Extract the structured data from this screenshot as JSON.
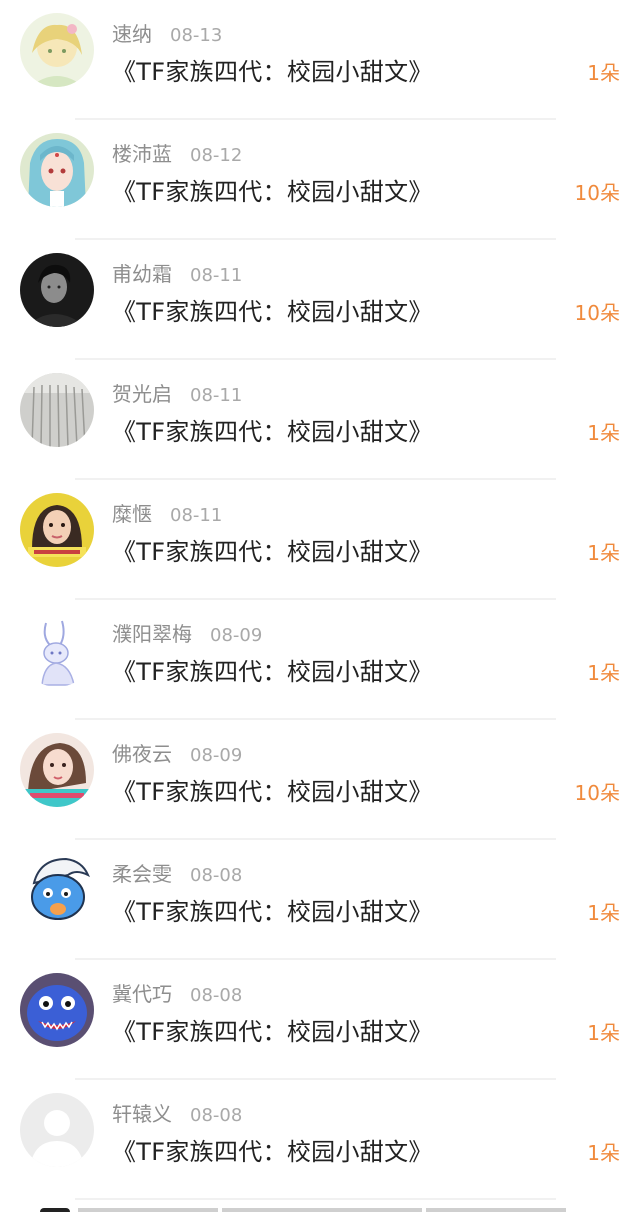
{
  "items": [
    {
      "user": "速纳",
      "date": "08-13",
      "book": "《TF家族四代：校园小甜文》",
      "amount": "1朵",
      "avatar": "avatar-anime-blonde"
    },
    {
      "user": "楼沛蓝",
      "date": "08-12",
      "book": "《TF家族四代：校园小甜文》",
      "amount": "10朵",
      "avatar": "avatar-anime-bluehair"
    },
    {
      "user": "甫幼霜",
      "date": "08-11",
      "book": "《TF家族四代：校园小甜文》",
      "amount": "10朵",
      "avatar": "avatar-dark-portrait"
    },
    {
      "user": "贺光启",
      "date": "08-11",
      "book": "《TF家族四代：校园小甜文》",
      "amount": "1朵",
      "avatar": "avatar-grey-curtain"
    },
    {
      "user": "糜惬",
      "date": "08-11",
      "book": "《TF家族四代：校园小甜文》",
      "amount": "1朵",
      "avatar": "avatar-girl-yellow"
    },
    {
      "user": "濮阳翠梅",
      "date": "08-09",
      "book": "《TF家族四代：校园小甜文》",
      "amount": "1朵",
      "avatar": "avatar-bunny-sketch"
    },
    {
      "user": "佛夜云",
      "date": "08-09",
      "book": "《TF家族四代：校园小甜文》",
      "amount": "10朵",
      "avatar": "avatar-girl-cyan"
    },
    {
      "user": "柔会雯",
      "date": "08-08",
      "book": "《TF家族四代：校园小甜文》",
      "amount": "1朵",
      "avatar": "avatar-blue-cartoon"
    },
    {
      "user": "冀代巧",
      "date": "08-08",
      "book": "《TF家族四代：校园小甜文》",
      "amount": "1朵",
      "avatar": "avatar-blue-monster"
    },
    {
      "user": "轩辕义",
      "date": "08-08",
      "book": "《TF家族四代：校园小甜文》",
      "amount": "1朵",
      "avatar": "avatar-default-placeholder"
    }
  ],
  "colors": {
    "name": "#8e8e8e",
    "date": "#a9a9a9",
    "book": "#222222",
    "amount": "#f08a3c"
  }
}
